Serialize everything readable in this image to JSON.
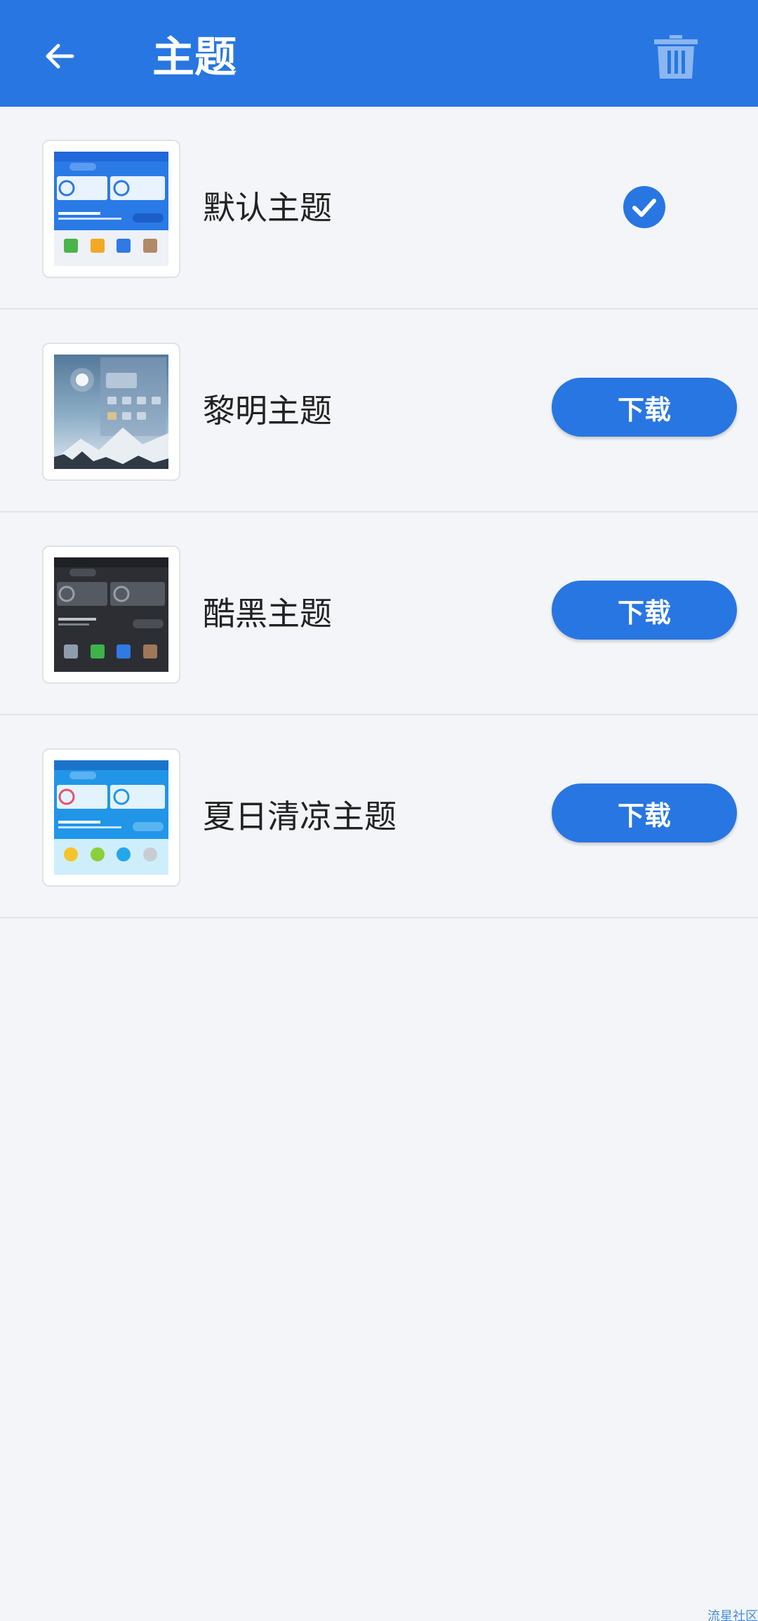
{
  "app_bar": {
    "title": "主题",
    "back_icon": "arrow-left-icon",
    "delete_icon": "trash-icon",
    "colors": {
      "background": "#2876e2",
      "text": "#ffffff",
      "trash": "#8bb6f1"
    }
  },
  "themes": [
    {
      "name": "默认主题",
      "state": "selected",
      "thumbnail": "default-theme-preview"
    },
    {
      "name": "黎明主题",
      "state": "download",
      "button_label": "下载",
      "thumbnail": "dawn-theme-preview"
    },
    {
      "name": "酷黑主题",
      "state": "download",
      "button_label": "下载",
      "thumbnail": "dark-theme-preview"
    },
    {
      "name": "夏日清凉主题",
      "state": "download",
      "button_label": "下载",
      "thumbnail": "summer-theme-preview"
    }
  ],
  "watermark": "流星社区",
  "colors": {
    "accent": "#2876e2",
    "page_background": "#f3f5f8",
    "divider": "#e1e4e9"
  }
}
